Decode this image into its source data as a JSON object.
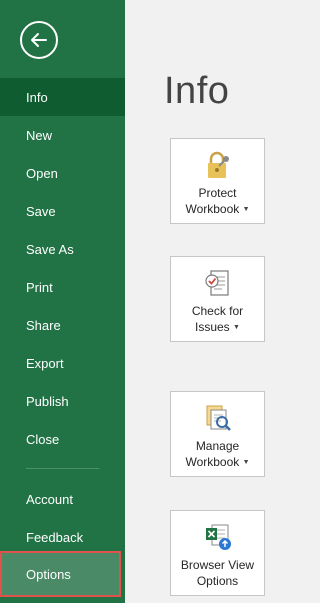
{
  "sidebar": {
    "items": [
      {
        "label": "Info"
      },
      {
        "label": "New"
      },
      {
        "label": "Open"
      },
      {
        "label": "Save"
      },
      {
        "label": "Save As"
      },
      {
        "label": "Print"
      },
      {
        "label": "Share"
      },
      {
        "label": "Export"
      },
      {
        "label": "Publish"
      },
      {
        "label": "Close"
      },
      {
        "label": "Account"
      },
      {
        "label": "Feedback"
      },
      {
        "label": "Options"
      }
    ],
    "active_item": "Info",
    "hovered_item": "Options"
  },
  "main": {
    "title": "Info",
    "cards": [
      {
        "line1": "Protect",
        "line2": "Workbook",
        "icon": "lock-key-icon",
        "dropdown": true
      },
      {
        "line1": "Check for",
        "line2": "Issues",
        "icon": "checklist-icon",
        "dropdown": true
      },
      {
        "line1": "Manage",
        "line2": "Workbook",
        "icon": "manage-documents-icon",
        "dropdown": true
      },
      {
        "line1": "Browser View",
        "line2": "Options",
        "icon": "excel-browser-icon",
        "dropdown": false
      }
    ]
  },
  "colors": {
    "sidebar_bg": "#217346",
    "active_bg": "#0e5c30",
    "hover_bg": "#4a8a66",
    "hover_border": "#e0524a",
    "main_bg": "#f1f1f1"
  }
}
